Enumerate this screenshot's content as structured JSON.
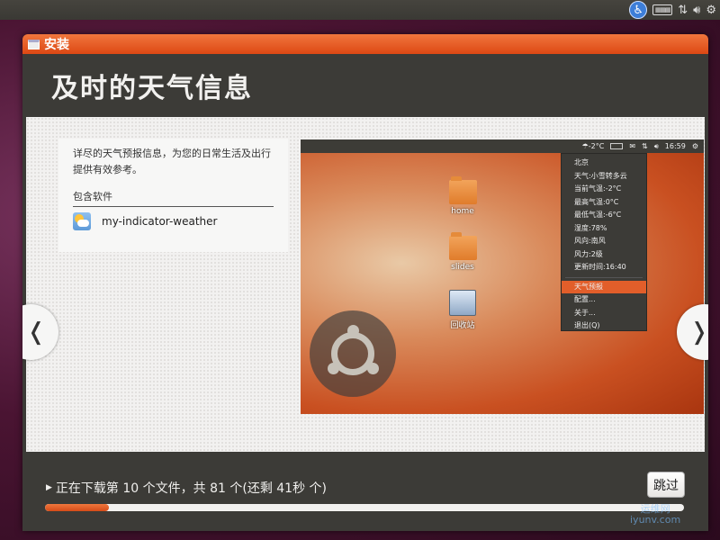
{
  "top_panel": {
    "icons": [
      "accessibility-icon",
      "keyboard-icon",
      "network-icon",
      "volume-icon",
      "gear-icon"
    ]
  },
  "window": {
    "title": "安装"
  },
  "page": {
    "heading": "及时的天气信息",
    "description": "详尽的天气预报信息，为您的日常生活及出行提供有效参考。",
    "included_software_label": "包含软件",
    "software_name": "my-indicator-weather"
  },
  "preview": {
    "panel_weather": "☂-2°C",
    "panel_time": "16:59",
    "desktop_items": [
      "home",
      "slides",
      "回收站"
    ],
    "menu_items": [
      "北京",
      "天气:小雪转多云",
      "当前气温:-2°C",
      "最高气温:0°C",
      "最低气温:-6°C",
      "湿度:78%",
      "风向:南风",
      "风力:2级",
      "更新时间:16:40"
    ],
    "menu_actions": [
      "天气预报",
      "配置...",
      "关于...",
      "退出(Q)"
    ],
    "highlight_action": "天气预报"
  },
  "footer": {
    "status_text": "正在下载第 10 个文件，共 81 个(还剩 41秒 个)",
    "skip_label": "跳过",
    "progress": 0.1
  },
  "nav": {
    "prev": "❬",
    "next": "❭"
  },
  "watermark": {
    "line1": "运维网",
    "line2": "iyunv.com"
  }
}
